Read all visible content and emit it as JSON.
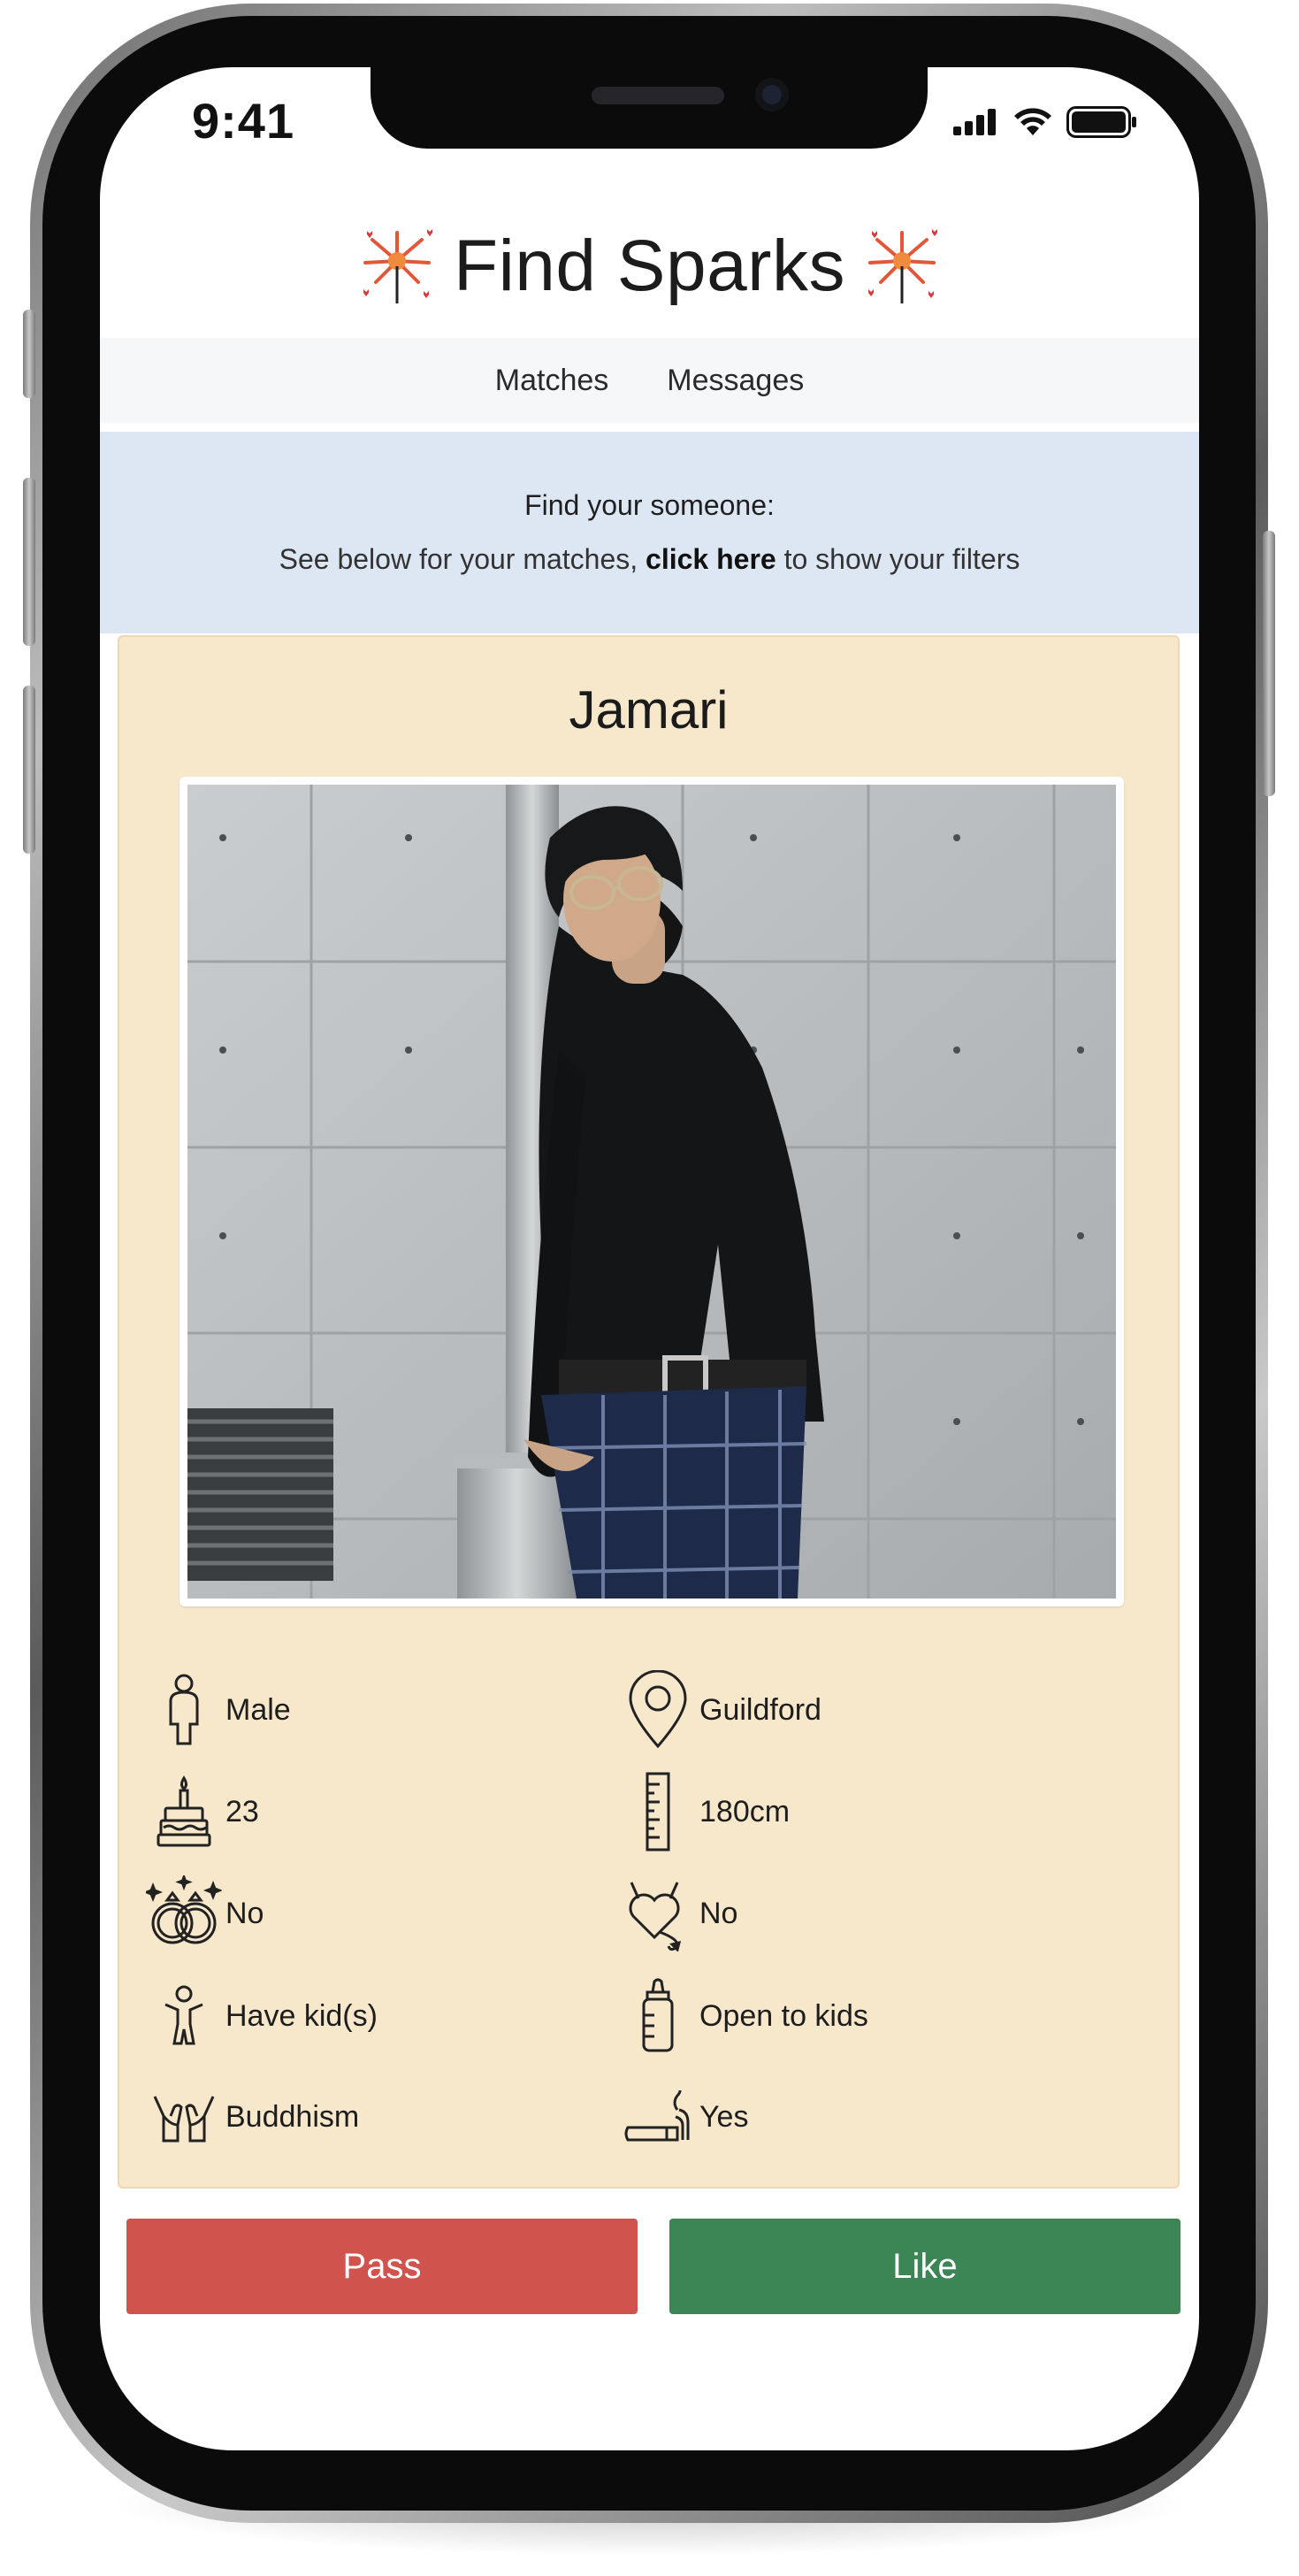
{
  "status_bar": {
    "time": "9:41"
  },
  "app": {
    "title": "Find Sparks",
    "title_icon": "sparkler-icon",
    "nav": [
      "Matches",
      "Messages"
    ]
  },
  "banner": {
    "heading": "Find your someone:",
    "text_before": "See below for your matches, ",
    "link": "click here",
    "text_after": " to show your filters"
  },
  "profile": {
    "name": "Jamari",
    "attributes": {
      "gender": {
        "icon": "person-icon",
        "value": "Male"
      },
      "location": {
        "icon": "map-pin-icon",
        "value": "Guildford"
      },
      "age": {
        "icon": "birthday-cake-icon",
        "value": "23"
      },
      "height": {
        "icon": "ruler-icon",
        "value": "180cm"
      },
      "married": {
        "icon": "wedding-rings-icon",
        "value": "No"
      },
      "devil_heart": {
        "icon": "devil-heart-icon",
        "value": "No"
      },
      "kids": {
        "icon": "child-icon",
        "value": "Have kid(s)"
      },
      "open_to_kids": {
        "icon": "baby-bottle-icon",
        "value": "Open to kids"
      },
      "religion": {
        "icon": "praying-hands-icon",
        "value": "Buddhism"
      },
      "smoking": {
        "icon": "cigarette-icon",
        "value": "Yes"
      }
    }
  },
  "actions": {
    "pass": "Pass",
    "like": "Like"
  },
  "colors": {
    "pass": "#d0534e",
    "like": "#3c8555",
    "card": "#f7e7cb",
    "banner": "#dce7f3"
  }
}
